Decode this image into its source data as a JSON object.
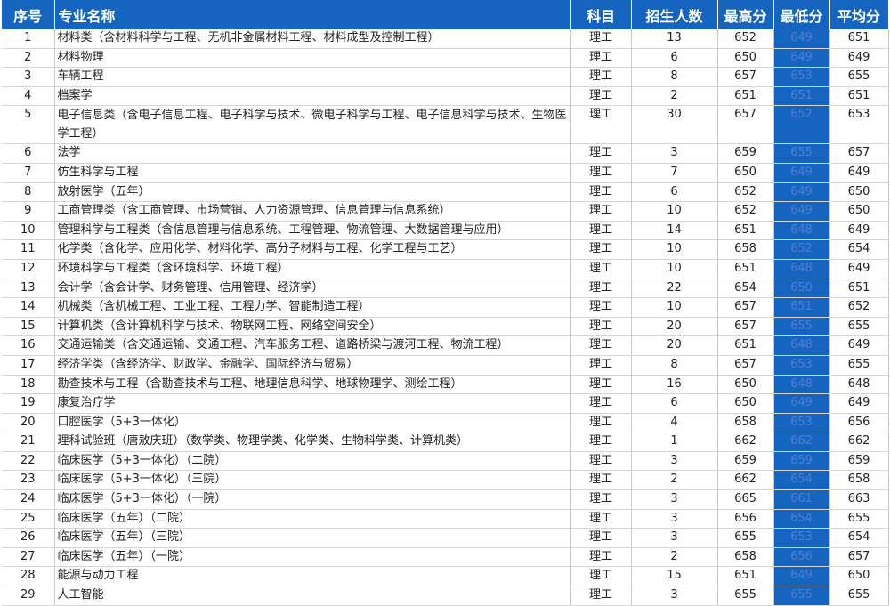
{
  "headers": [
    "序号",
    "专业名称",
    "科目",
    "招生人数",
    "最高分",
    "最低分",
    "平均分"
  ],
  "rows": [
    {
      "no": "1",
      "name": "材料类（含材料科学与工程、无机非金属材料工程、材料成型及控制工程）",
      "subject": "理工",
      "quota": "13",
      "max": "652",
      "min": "649",
      "avg": "651"
    },
    {
      "no": "2",
      "name": "材料物理",
      "subject": "理工",
      "quota": "6",
      "max": "650",
      "min": "649",
      "avg": "649"
    },
    {
      "no": "3",
      "name": "车辆工程",
      "subject": "理工",
      "quota": "8",
      "max": "657",
      "min": "653",
      "avg": "655"
    },
    {
      "no": "4",
      "name": "档案学",
      "subject": "理工",
      "quota": "2",
      "max": "651",
      "min": "651",
      "avg": "651"
    },
    {
      "no": "5",
      "name": "电子信息类（含电子信息工程、电子科学与技术、微电子科学与工程、电子信息科学与技术、生物医学工程）",
      "subject": "理工",
      "quota": "30",
      "max": "657",
      "min": "652",
      "avg": "653"
    },
    {
      "no": "6",
      "name": "法学",
      "subject": "理工",
      "quota": "3",
      "max": "659",
      "min": "655",
      "avg": "657"
    },
    {
      "no": "7",
      "name": "仿生科学与工程",
      "subject": "理工",
      "quota": "7",
      "max": "650",
      "min": "649",
      "avg": "649"
    },
    {
      "no": "8",
      "name": "放射医学（五年）",
      "subject": "理工",
      "quota": "6",
      "max": "652",
      "min": "649",
      "avg": "650"
    },
    {
      "no": "9",
      "name": "工商管理类（含工商管理、市场营销、人力资源管理、信息管理与信息系统）",
      "subject": "理工",
      "quota": "10",
      "max": "652",
      "min": "649",
      "avg": "650"
    },
    {
      "no": "10",
      "name": "管理科学与工程类（含信息管理与信息系统、工程管理、物流管理、大数据管理与应用）",
      "subject": "理工",
      "quota": "14",
      "max": "651",
      "min": "648",
      "avg": "649"
    },
    {
      "no": "11",
      "name": "化学类（含化学、应用化学、材料化学、高分子材料与工程、化学工程与工艺）",
      "subject": "理工",
      "quota": "10",
      "max": "658",
      "min": "652",
      "avg": "654"
    },
    {
      "no": "12",
      "name": "环境科学与工程类（含环境科学、环境工程）",
      "subject": "理工",
      "quota": "10",
      "max": "651",
      "min": "648",
      "avg": "649"
    },
    {
      "no": "13",
      "name": "会计学（含会计学、财务管理、信用管理、经济学）",
      "subject": "理工",
      "quota": "22",
      "max": "654",
      "min": "650",
      "avg": "651"
    },
    {
      "no": "14",
      "name": "机械类（含机械工程、工业工程、工程力学、智能制造工程）",
      "subject": "理工",
      "quota": "10",
      "max": "657",
      "min": "651",
      "avg": "652"
    },
    {
      "no": "15",
      "name": "计算机类（含计算机科学与技术、物联网工程、网络空间安全）",
      "subject": "理工",
      "quota": "20",
      "max": "657",
      "min": "655",
      "avg": "655"
    },
    {
      "no": "16",
      "name": "交通运输类（含交通运输、交通工程、汽车服务工程、道路桥梁与渡河工程、物流工程）",
      "subject": "理工",
      "quota": "20",
      "max": "651",
      "min": "648",
      "avg": "649"
    },
    {
      "no": "17",
      "name": "经济学类（含经济学、财政学、金融学、国际经济与贸易）",
      "subject": "理工",
      "quota": "8",
      "max": "657",
      "min": "653",
      "avg": "655"
    },
    {
      "no": "18",
      "name": "勘查技术与工程（含勘查技术与工程、地理信息科学、地球物理学、测绘工程）",
      "subject": "理工",
      "quota": "16",
      "max": "650",
      "min": "648",
      "avg": "648"
    },
    {
      "no": "19",
      "name": "康复治疗学",
      "subject": "理工",
      "quota": "6",
      "max": "650",
      "min": "649",
      "avg": "649"
    },
    {
      "no": "20",
      "name": "口腔医学（5+3一体化）",
      "subject": "理工",
      "quota": "4",
      "max": "658",
      "min": "653",
      "avg": "656"
    },
    {
      "no": "21",
      "name": "理科试验班（唐敖庆班）（数学类、物理学类、化学类、生物科学类、计算机类）",
      "subject": "理工",
      "quota": "1",
      "max": "662",
      "min": "662",
      "avg": "662"
    },
    {
      "no": "22",
      "name": "临床医学（5+3一体化）（二院）",
      "subject": "理工",
      "quota": "3",
      "max": "659",
      "min": "659",
      "avg": "659"
    },
    {
      "no": "23",
      "name": "临床医学（5+3一体化）（三院）",
      "subject": "理工",
      "quota": "2",
      "max": "662",
      "min": "654",
      "avg": "658"
    },
    {
      "no": "24",
      "name": "临床医学（5+3一体化）（一院）",
      "subject": "理工",
      "quota": "3",
      "max": "665",
      "min": "661",
      "avg": "663"
    },
    {
      "no": "25",
      "name": "临床医学（五年）（二院）",
      "subject": "理工",
      "quota": "3",
      "max": "656",
      "min": "654",
      "avg": "655"
    },
    {
      "no": "26",
      "name": "临床医学（五年）（三院）",
      "subject": "理工",
      "quota": "3",
      "max": "655",
      "min": "653",
      "avg": "654"
    },
    {
      "no": "27",
      "name": "临床医学（五年）（一院）",
      "subject": "理工",
      "quota": "2",
      "max": "658",
      "min": "656",
      "avg": "657"
    },
    {
      "no": "28",
      "name": "能源与动力工程",
      "subject": "理工",
      "quota": "15",
      "max": "651",
      "min": "649",
      "avg": "650"
    },
    {
      "no": "29",
      "name": "人工智能",
      "subject": "理工",
      "quota": "3",
      "max": "655",
      "min": "655",
      "avg": "655"
    }
  ],
  "colors": {
    "header_bg": "#1565c0",
    "min_score_bg": "#1565c0",
    "min_score_text": "#4f7fd0"
  }
}
